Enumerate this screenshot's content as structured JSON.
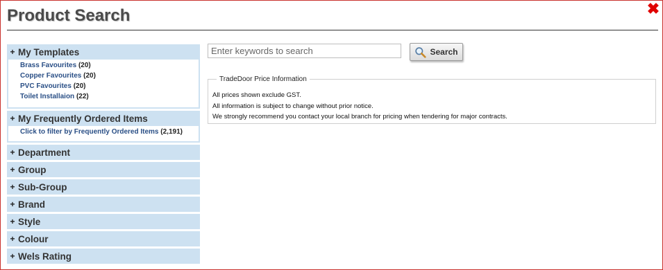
{
  "header": {
    "title": "Product Search",
    "close_icon": "close-icon"
  },
  "sidebar": {
    "templates": {
      "label": "My Templates",
      "links": [
        {
          "label": "Brass Favourites",
          "count": "(20)"
        },
        {
          "label": "Copper Favourites",
          "count": "(20)"
        },
        {
          "label": "PVC Favourites",
          "count": "(20)"
        },
        {
          "label": "Toilet Installaion",
          "count": "(22)"
        }
      ]
    },
    "frequent": {
      "label": "My Frequently Ordered Items",
      "links": [
        {
          "label": "Click to filter by Frequently Ordered Items",
          "count": "(2,191)"
        }
      ]
    },
    "facets": [
      {
        "label": "Department"
      },
      {
        "label": "Group"
      },
      {
        "label": "Sub-Group"
      },
      {
        "label": "Brand"
      },
      {
        "label": "Style"
      },
      {
        "label": "Colour"
      },
      {
        "label": "Wels Rating"
      }
    ],
    "expand_symbol": "+"
  },
  "search": {
    "placeholder": "Enter keywords to search",
    "value": "",
    "button_label": "Search",
    "button_icon": "magnifier-icon"
  },
  "info": {
    "legend": "TradeDoor Price Information",
    "lines": [
      "All prices shown exclude GST.",
      "All information is subject to change without prior notice.",
      "We strongly recommend you contact your local branch for pricing when tendering for major contracts."
    ]
  },
  "colors": {
    "accent_blue": "#cde1f1",
    "link": "#2a4f86",
    "close": "#e00000",
    "frame_border": "#c9302c"
  }
}
